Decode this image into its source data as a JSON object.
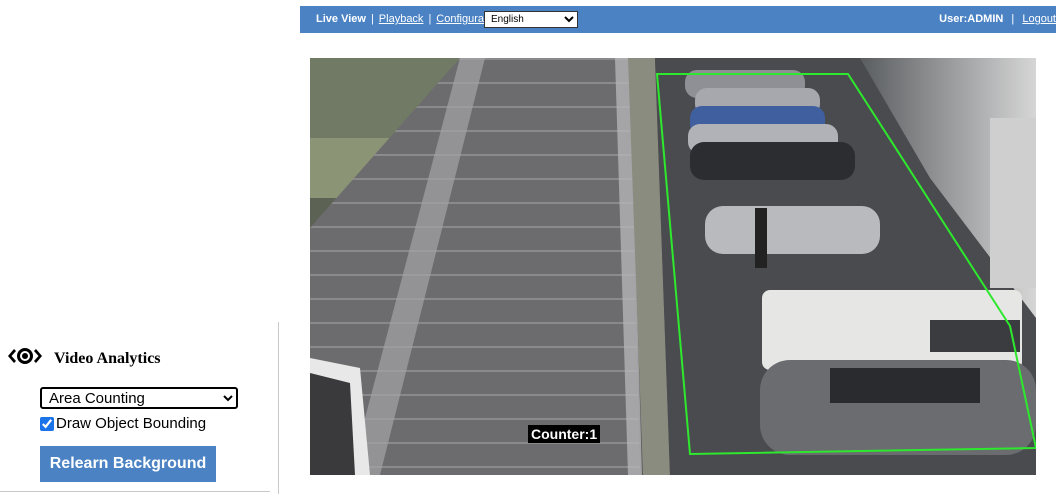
{
  "nav": {
    "live_view": "Live View",
    "playback": "Playback",
    "configuration": "Configuration",
    "separator": "|",
    "language_selected": "English",
    "user": "User:ADMIN",
    "logout": "Logout"
  },
  "video": {
    "counter_label": "Counter:1"
  },
  "analytics": {
    "title": "Video Analytics",
    "mode_selected": "Area Counting",
    "draw_bounding_label": "Draw Object Bounding",
    "draw_bounding_checked": true,
    "relearn_label": "Relearn Background"
  },
  "colors": {
    "accent": "#4a82c4",
    "detection_zone": "#2ee82e"
  },
  "icons": {
    "analytics": "eye-icon"
  }
}
